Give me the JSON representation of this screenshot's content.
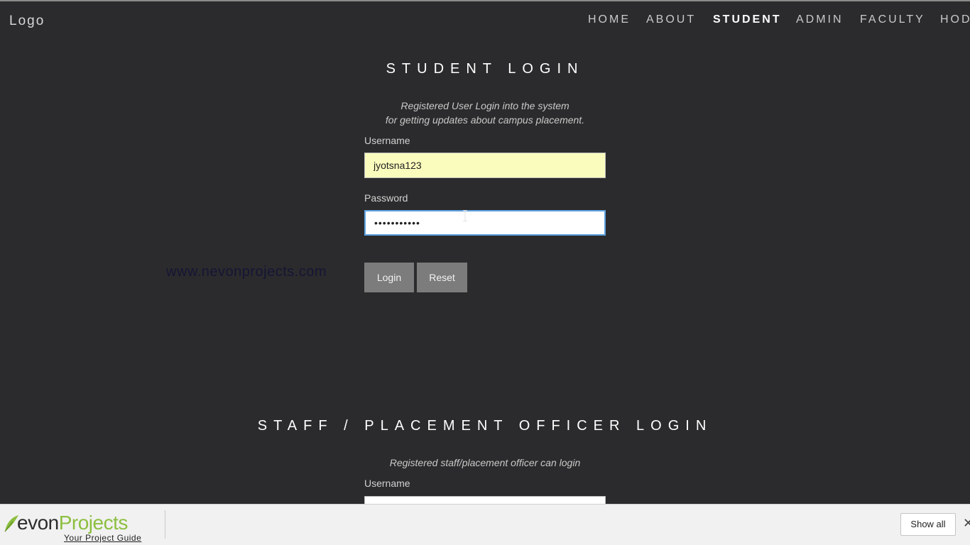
{
  "nav": {
    "logo": "Logo",
    "items": [
      {
        "label": "HOME"
      },
      {
        "label": "ABOUT"
      },
      {
        "label": "STUDENT"
      },
      {
        "label": "ADMIN"
      },
      {
        "label": "FACULTY"
      },
      {
        "label": "HOD"
      }
    ],
    "active": "STUDENT"
  },
  "student_login": {
    "title": "STUDENT LOGIN",
    "subtitle_line1": "Registered User Login into the system",
    "subtitle_line2": "for getting updates about campus placement.",
    "username_label": "Username",
    "username_value": "jyotsna123",
    "password_label": "Password",
    "password_value": "•••••••••••",
    "login_button": "Login",
    "reset_button": "Reset"
  },
  "staff_login": {
    "title": "STAFF / PLACEMENT OFFICER LOGIN",
    "subtitle": "Registered staff/placement officer can login",
    "username_label": "Username"
  },
  "watermark": {
    "url": "www.nevonprojects.com"
  },
  "download_bar": {
    "brand_prefix": "evon",
    "brand_accent": "Projects",
    "brand_tagline": "Your Project Guide",
    "show_all": "Show all",
    "close": "✕"
  },
  "colors": {
    "background": "#2b2b2d",
    "username_autofill": "#fafcbd",
    "focus_border": "#5fa3e0",
    "button": "#7c7c7c",
    "brand_green": "#8cbf3f"
  }
}
